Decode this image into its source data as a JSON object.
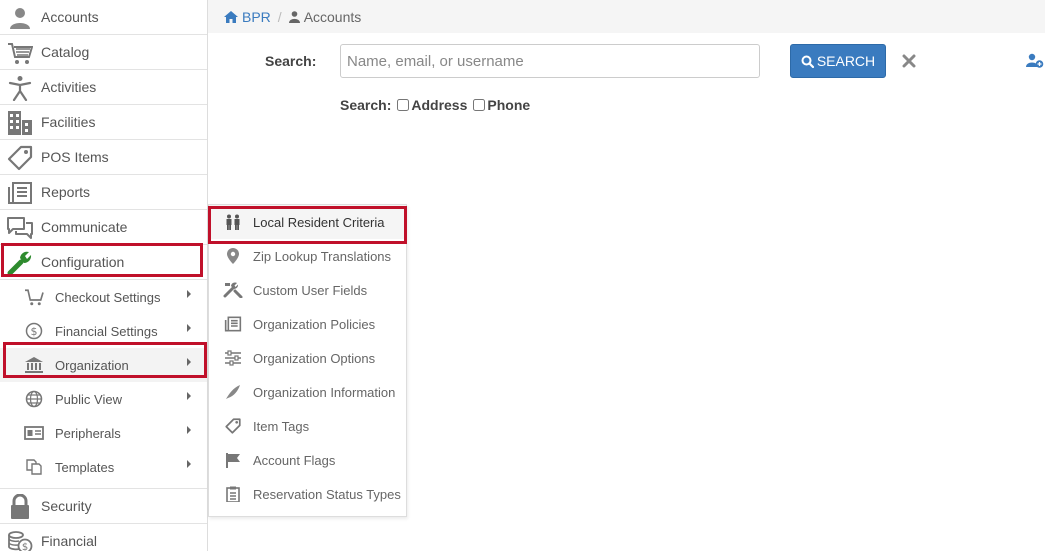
{
  "sidebar": {
    "top_items": [
      {
        "label": "Accounts",
        "icon": "user-icon"
      },
      {
        "label": "Catalog",
        "icon": "cart-icon"
      },
      {
        "label": "Activities",
        "icon": "person-activity-icon"
      },
      {
        "label": "Facilities",
        "icon": "building-icon"
      },
      {
        "label": "POS Items",
        "icon": "tag-icon"
      },
      {
        "label": "Reports",
        "icon": "reports-icon"
      },
      {
        "label": "Communicate",
        "icon": "chat-icon"
      },
      {
        "label": "Configuration",
        "icon": "wrench-icon"
      }
    ],
    "config_sub": [
      {
        "label": "Checkout Settings",
        "icon": "cart-icon"
      },
      {
        "label": "Financial Settings",
        "icon": "dollar-circle-icon"
      },
      {
        "label": "Organization",
        "icon": "bank-icon"
      },
      {
        "label": "Public View",
        "icon": "globe-icon"
      },
      {
        "label": "Peripherals",
        "icon": "id-card-icon"
      },
      {
        "label": "Templates",
        "icon": "copy-icon"
      }
    ],
    "bottom_items": [
      {
        "label": "Security",
        "icon": "lock-icon"
      },
      {
        "label": "Financial",
        "icon": "coins-icon"
      }
    ]
  },
  "breadcrumb": {
    "home": "BPR",
    "separator": "/",
    "current": "Accounts"
  },
  "search": {
    "label": "Search:",
    "placeholder": "Name, email, or username",
    "value": "",
    "button_label": "SEARCH",
    "options_label": "Search:",
    "option_address": "Address",
    "option_phone": "Phone"
  },
  "flyout": {
    "items": [
      {
        "label": "Local Resident Criteria",
        "icon": "people-icon"
      },
      {
        "label": "Zip Lookup Translations",
        "icon": "map-marker-icon"
      },
      {
        "label": "Custom User Fields",
        "icon": "tools-icon"
      },
      {
        "label": "Organization Policies",
        "icon": "reports-icon"
      },
      {
        "label": "Organization Options",
        "icon": "sliders-icon"
      },
      {
        "label": "Organization Information",
        "icon": "feather-icon"
      },
      {
        "label": "Item Tags",
        "icon": "tag-icon"
      },
      {
        "label": "Account Flags",
        "icon": "flag-icon"
      },
      {
        "label": "Reservation Status Types",
        "icon": "clipboard-icon"
      }
    ]
  },
  "colors": {
    "accent": "#3a7bbf",
    "highlight": "#c0102a",
    "wrench": "#2e8b2e"
  }
}
